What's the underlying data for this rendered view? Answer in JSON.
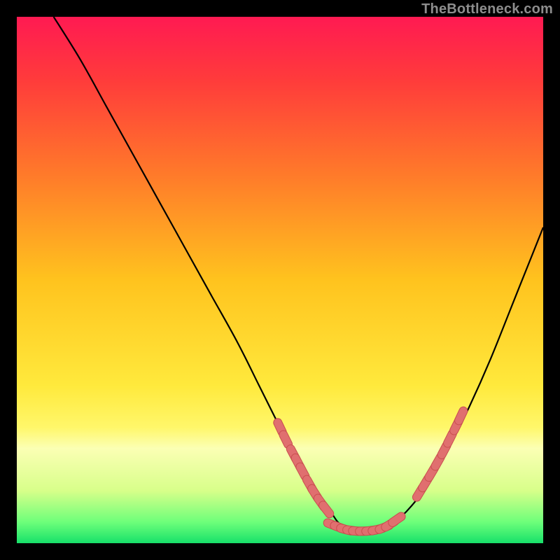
{
  "watermark": "TheBottleneck.com",
  "colors": {
    "frame": "#000000",
    "watermark": "#8d8d8d",
    "curve": "#000000",
    "marker_fill": "#e06f6f",
    "marker_stroke": "#c94f4f",
    "gradient_stops": [
      {
        "offset": 0.0,
        "color": "#ff1a52"
      },
      {
        "offset": 0.12,
        "color": "#ff3b3b"
      },
      {
        "offset": 0.3,
        "color": "#ff7a2a"
      },
      {
        "offset": 0.5,
        "color": "#ffc31e"
      },
      {
        "offset": 0.7,
        "color": "#ffe93c"
      },
      {
        "offset": 0.78,
        "color": "#fff76a"
      },
      {
        "offset": 0.82,
        "color": "#fbffb4"
      },
      {
        "offset": 0.9,
        "color": "#d8ff8a"
      },
      {
        "offset": 0.96,
        "color": "#6dff7a"
      },
      {
        "offset": 1.0,
        "color": "#17e06a"
      }
    ]
  },
  "chart_data": {
    "type": "line",
    "title": "",
    "xlabel": "",
    "ylabel": "",
    "xlim": [
      0,
      100
    ],
    "ylim": [
      0,
      100
    ],
    "grid": false,
    "legend": false,
    "series": [
      {
        "name": "bottleneck-curve",
        "x": [
          7,
          12,
          17,
          22,
          27,
          32,
          37,
          42,
          46,
          50,
          53,
          56,
          59,
          61,
          63,
          65,
          68,
          71,
          74,
          78,
          82,
          86,
          90,
          94,
          98,
          100
        ],
        "y": [
          100,
          92,
          83,
          74,
          65,
          56,
          47,
          38,
          30,
          22,
          16,
          11,
          7,
          4,
          2.5,
          2,
          2.2,
          3.5,
          6,
          11,
          18,
          26,
          35,
          45,
          55,
          60
        ]
      }
    ],
    "markers_left": {
      "name": "left-cluster",
      "x": [
        50.0,
        51.1,
        52.5,
        53.4,
        54.3,
        55.6,
        56.6,
        57.8,
        58.8
      ],
      "y": [
        22.0,
        19.7,
        17.0,
        15.3,
        13.6,
        11.2,
        9.5,
        7.7,
        6.4
      ]
    },
    "markers_bottom": {
      "name": "bottom-cluster",
      "x": [
        60.0,
        61.3,
        62.5,
        63.7,
        64.8,
        66.1,
        67.3,
        68.5,
        69.8,
        70.9,
        72.2
      ],
      "y": [
        3.5,
        3.0,
        2.6,
        2.4,
        2.3,
        2.3,
        2.4,
        2.6,
        3.0,
        3.6,
        4.5
      ]
    },
    "markers_right": {
      "name": "right-cluster",
      "x": [
        76.5,
        77.6,
        78.8,
        80.0,
        81.2,
        82.3,
        83.5,
        84.4
      ],
      "y": [
        9.6,
        11.4,
        13.4,
        15.5,
        17.7,
        19.9,
        22.3,
        24.2
      ]
    }
  }
}
